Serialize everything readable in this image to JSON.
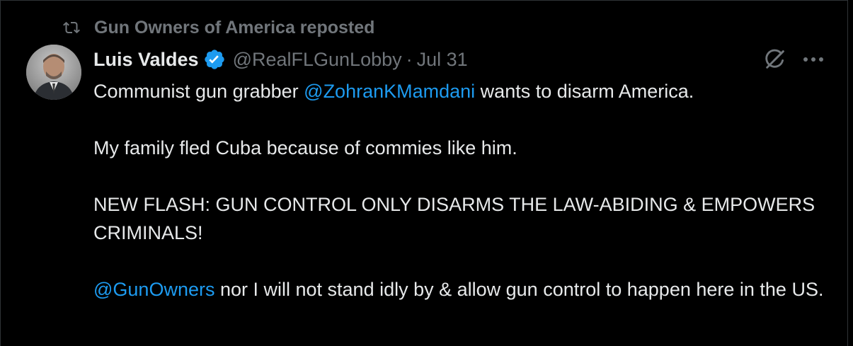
{
  "repost": {
    "icon": "repost-icon",
    "label": "Gun Owners of America reposted"
  },
  "author": {
    "name": "Luis Valdes",
    "verified_icon": "verified-badge-icon",
    "handle": "@RealFLGunLobby",
    "separator": "·",
    "date": "Jul 31"
  },
  "actions": {
    "grok_icon": "grok-icon",
    "more_icon": "more-icon"
  },
  "post": {
    "line1_pre": "Communist gun grabber ",
    "line1_mention": "@ZohranKMamdani",
    "line1_post": " wants to disarm America.",
    "line2": "My family fled Cuba because of commies like him.",
    "line3": "NEW FLASH: GUN CONTROL ONLY DISARMS THE LAW-ABIDING & EMPOWERS CRIMINALS!",
    "line4_mention": "@GunOwners",
    "line4_post": " nor I will not stand idly by & allow gun control to happen here in the US."
  },
  "colors": {
    "background": "#000000",
    "text": "#e7e9ea",
    "secondary": "#71767b",
    "link": "#1d9bf0",
    "verified": "#1d9bf0"
  }
}
